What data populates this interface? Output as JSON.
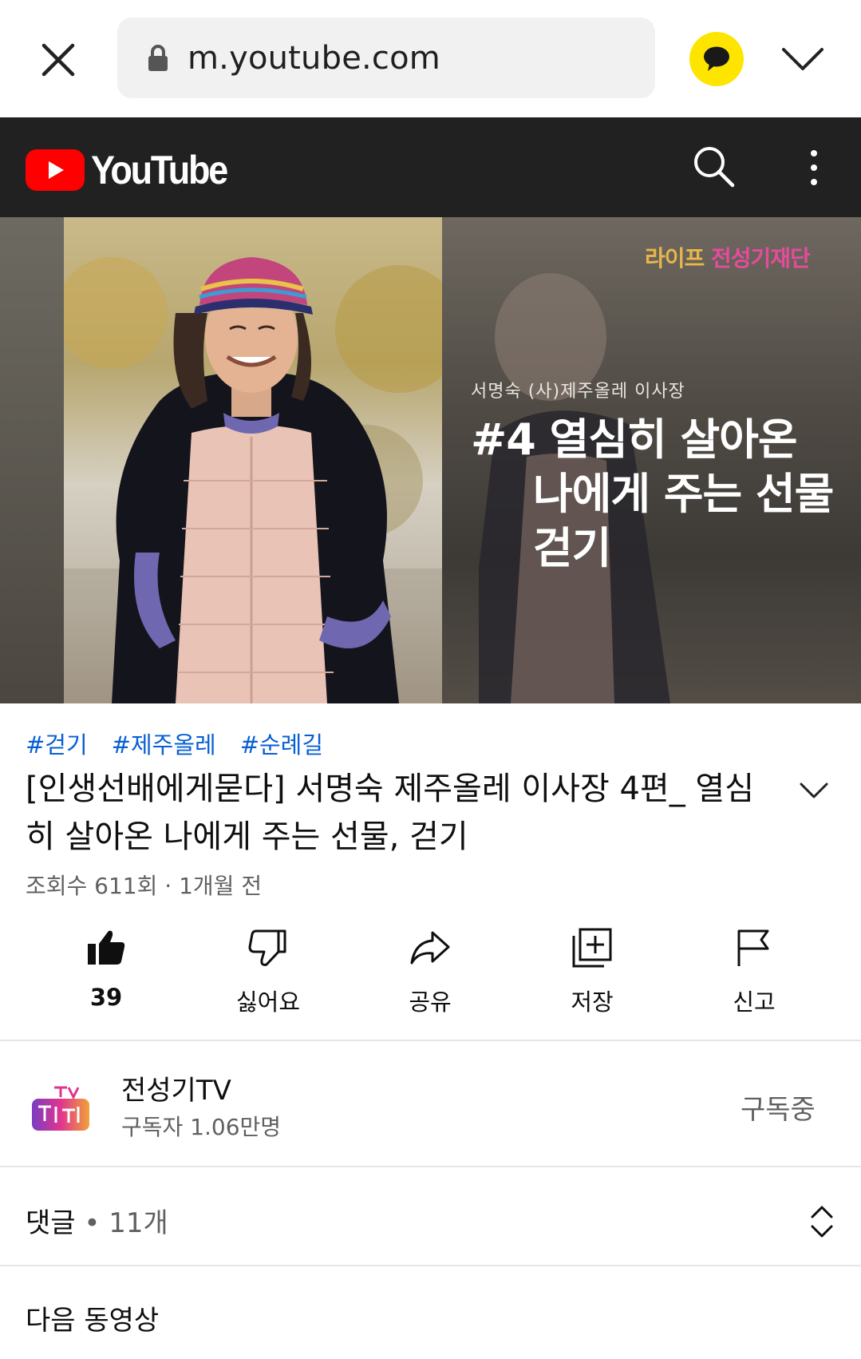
{
  "browser": {
    "url": "m.youtube.com",
    "icons": [
      "close-icon",
      "lock-icon",
      "kakao-talk-icon",
      "chevron-down-icon"
    ]
  },
  "header": {
    "logo_text": "YouTube",
    "icons": [
      "youtube-logo",
      "search-icon",
      "more-vert-icon"
    ]
  },
  "video": {
    "overlay_brand": "라이프 전성기재단",
    "overlay_brand_part1": "라이프",
    "overlay_brand_part2": "전성기재단",
    "overlay_subtitle": "서명숙 (사)제주올레 이사장",
    "overlay_title_line1": "#4 열심히 살아온",
    "overlay_title_line2": "나에게 주는 선물",
    "overlay_title_line3": "걷기"
  },
  "info": {
    "hashtags": [
      "#걷기",
      "#제주올레",
      "#순례길"
    ],
    "title": "[인생선배에게묻다] 서명숙 제주올레 이사장 4편_ 열심히 살아온 나에게 주는 선물, 걷기",
    "meta": "조회수 611회 · 1개월 전"
  },
  "actions": {
    "like": "39",
    "dislike": "싫어요",
    "share": "공유",
    "save": "저장",
    "report": "신고"
  },
  "channel": {
    "name": "전성기TV",
    "subscribers": "구독자 1.06만명",
    "subscribe_state": "구독중"
  },
  "comments": {
    "label": "댓글",
    "count": "11개"
  },
  "next": {
    "label": "다음 동영상"
  },
  "colors": {
    "header_bg": "#212121",
    "youtube_red": "#ff0000",
    "hashtag_blue": "#065fd4",
    "kakao_yellow": "#fee500",
    "secondary_text": "#606060"
  }
}
